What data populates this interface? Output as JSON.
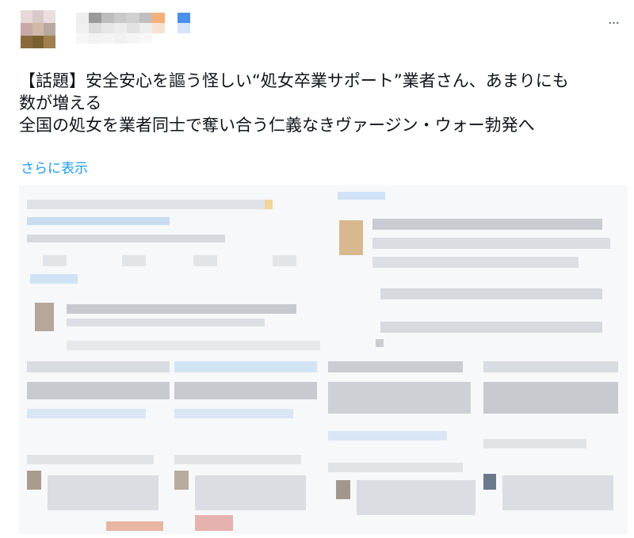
{
  "post": {
    "text_lines": [
      "【話題】安全安心を謳う怪しい“処女卒業サポート”業者さん、あまりにも",
      "数が増える",
      "全国の処女を業者同士で奪い合う仁義なきヴァージン・ウォー勃発へ"
    ],
    "show_more_label": "さらに表示",
    "more_icon": "more-horizontal-icon",
    "more_label": "···"
  },
  "colors": {
    "text": "#0f1419",
    "link": "#1d9bf0",
    "icon": "#536471",
    "media_bg": "#f7f8f9"
  }
}
